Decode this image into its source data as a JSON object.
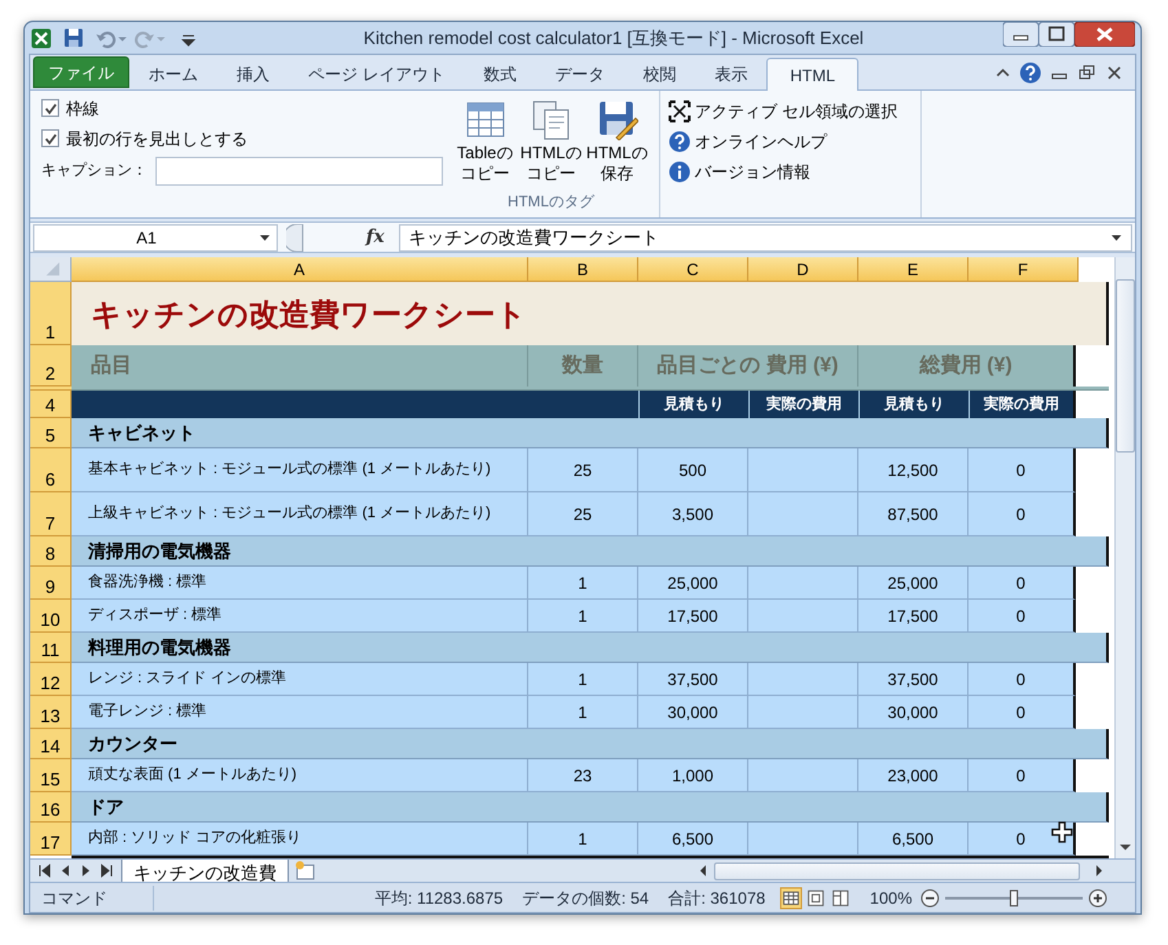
{
  "window": {
    "title": "Kitchen remodel cost calculator1  [互換モード] - Microsoft Excel"
  },
  "ribbon_tabs": [
    {
      "label": "ファイル",
      "kind": "file",
      "selected": false
    },
    {
      "label": "ホーム",
      "kind": "tab",
      "selected": false
    },
    {
      "label": "挿入",
      "kind": "tab",
      "selected": false
    },
    {
      "label": "ページ レイアウト",
      "kind": "tab",
      "selected": false
    },
    {
      "label": "数式",
      "kind": "tab",
      "selected": false
    },
    {
      "label": "データ",
      "kind": "tab",
      "selected": false
    },
    {
      "label": "校閲",
      "kind": "tab",
      "selected": false
    },
    {
      "label": "表示",
      "kind": "tab",
      "selected": false
    },
    {
      "label": "HTML",
      "kind": "tab",
      "selected": true
    }
  ],
  "ribbon": {
    "options": [
      {
        "label": "枠線",
        "checked": true
      },
      {
        "label": "最初の行を見出しとする",
        "checked": true
      }
    ],
    "caption_label": "キャプション：",
    "buttons": [
      {
        "lines": [
          "Tableの",
          "コピー"
        ],
        "kind": "table"
      },
      {
        "lines": [
          "HTMLの",
          "コピー"
        ],
        "kind": "copy"
      },
      {
        "lines": [
          "HTMLの",
          "保存"
        ],
        "kind": "save"
      }
    ],
    "group_label": "HTMLのタグ",
    "commands": [
      {
        "label": "アクティブ セル領域の選択",
        "kind": "select"
      },
      {
        "label": "オンラインヘルプ",
        "kind": "help"
      },
      {
        "label": "バージョン情報",
        "kind": "info"
      }
    ]
  },
  "formula_bar": {
    "name_box": "A1",
    "fx": "fx",
    "formula": "キッチンの改造費ワークシート"
  },
  "columns": [
    "A",
    "B",
    "C",
    "D",
    "E",
    "F"
  ],
  "rows": [
    {
      "number": "1",
      "kind": "title",
      "text": "キッチンの改造費ワークシート"
    },
    {
      "number": "2",
      "kind": "header",
      "texts": [
        "品目",
        "数量",
        "品目ごとの 費用 (¥)",
        "総費用 (¥)"
      ]
    },
    {
      "kind": "hidden"
    },
    {
      "number": "4",
      "kind": "subheader",
      "texts": [
        "見積もり",
        "実際の費用",
        "見積もり",
        "実際の費用"
      ]
    },
    {
      "number": "5",
      "kind": "category",
      "text": "キャビネット"
    },
    {
      "number": "6",
      "kind": "item",
      "tall": true,
      "item": "基本キャビネット : モジュール式の標準 (1 メートルあたり)",
      "quantity": "25",
      "estimate": "500",
      "total_estimate": "12,500",
      "total_actual": "0"
    },
    {
      "number": "7",
      "kind": "item",
      "tall": true,
      "item": "上級キャビネット : モジュール式の標準 (1 メートルあたり)",
      "quantity": "25",
      "estimate": "3,500",
      "total_estimate": "87,500",
      "total_actual": "0"
    },
    {
      "number": "8",
      "kind": "category",
      "text": "清掃用の電気機器"
    },
    {
      "number": "9",
      "kind": "item",
      "tall": false,
      "item": "食器洗浄機 : 標準",
      "quantity": "1",
      "estimate": "25,000",
      "total_estimate": "25,000",
      "total_actual": "0"
    },
    {
      "number": "10",
      "kind": "item",
      "tall": false,
      "item": "ディスポーザ : 標準",
      "quantity": "1",
      "estimate": "17,500",
      "total_estimate": "17,500",
      "total_actual": "0"
    },
    {
      "number": "11",
      "kind": "category",
      "text": "料理用の電気機器"
    },
    {
      "number": "12",
      "kind": "item",
      "tall": false,
      "item": "レンジ : スライド インの標準",
      "quantity": "1",
      "estimate": "37,500",
      "total_estimate": "37,500",
      "total_actual": "0"
    },
    {
      "number": "13",
      "kind": "item",
      "tall": false,
      "item": "電子レンジ : 標準",
      "quantity": "1",
      "estimate": "30,000",
      "total_estimate": "30,000",
      "total_actual": "0"
    },
    {
      "number": "14",
      "kind": "category",
      "text": "カウンター"
    },
    {
      "number": "15",
      "kind": "item",
      "tall": false,
      "item": "頑丈な表面 (1 メートルあたり)",
      "quantity": "23",
      "estimate": "1,000",
      "total_estimate": "23,000",
      "total_actual": "0"
    },
    {
      "number": "16",
      "kind": "category",
      "text": "ドア"
    },
    {
      "number": "17",
      "kind": "item",
      "tall": false,
      "item": "内部 : ソリッド コアの化粧張り",
      "quantity": "1",
      "estimate": "6,500",
      "total_estimate": "6,500",
      "total_actual": "0"
    }
  ],
  "sheet_tabs": [
    {
      "label": "キッチンの改造費",
      "selected": true
    }
  ],
  "status_bar": {
    "mode": "コマンド",
    "average": "平均: 11283.6875",
    "count": "データの個数: 54",
    "sum": "合計: 361078",
    "views": [
      {
        "kind": "normal",
        "selected": true
      },
      {
        "kind": "layout",
        "selected": false
      },
      {
        "kind": "pagebreak",
        "selected": false
      }
    ],
    "zoom": "100%",
    "zoom_slider": {
      "level": 0.5
    }
  }
}
